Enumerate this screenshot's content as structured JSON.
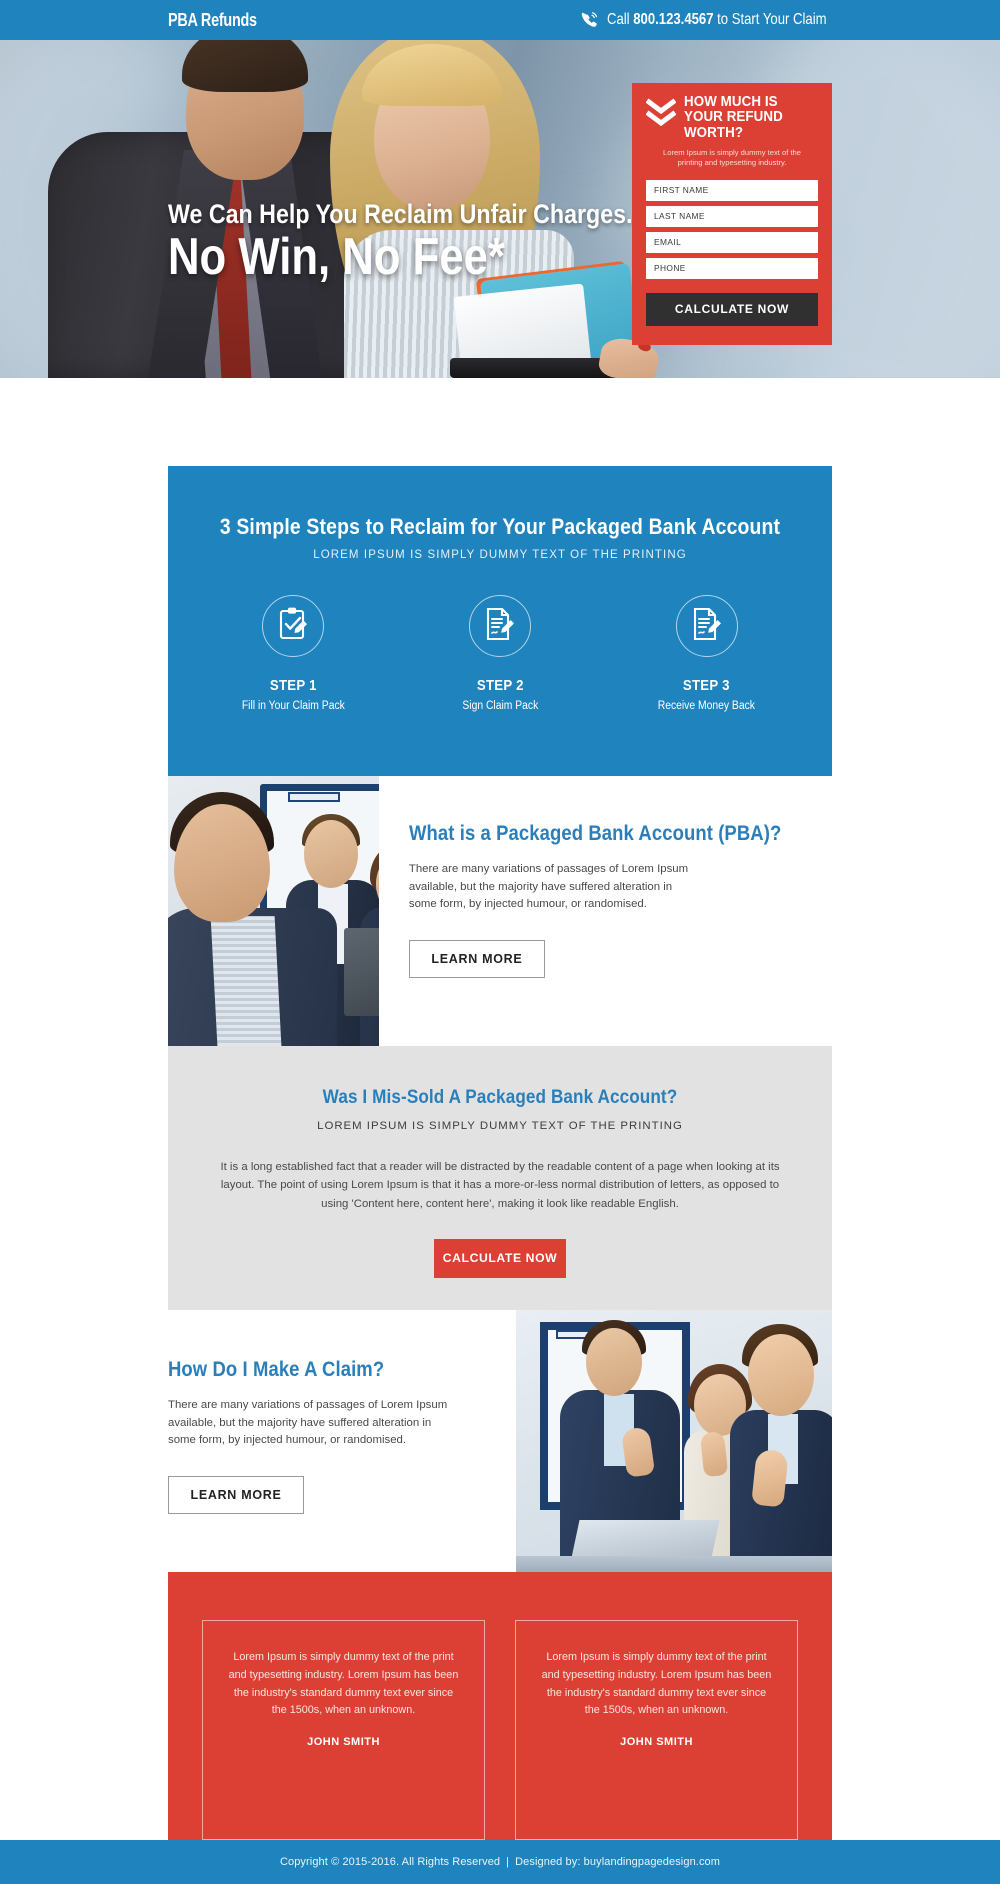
{
  "header": {
    "brand_bold": "PBA",
    "brand_light": " Refunds",
    "phone_icon": "phone-ringing-icon",
    "call_prefix": "Call ",
    "call_number": "800.123.4567",
    "call_suffix": " to Start Your Claim"
  },
  "hero": {
    "headline_line1": "We Can Help You Reclaim Unfair Charges.",
    "headline_line2": "No Win, No Fee*",
    "image_alt": "businessman-and-woman-reviewing-documents"
  },
  "lead_form": {
    "chevron_icon": "double-chevron-down-icon",
    "title": "HOW MUCH IS YOUR REFUND WORTH?",
    "subtitle": "Lorem Ipsum is simply dummy text of the printing and typesetting industry.",
    "fields": [
      {
        "name": "first-name",
        "placeholder": "FIRST NAME",
        "value": ""
      },
      {
        "name": "last-name",
        "placeholder": "LAST NAME",
        "value": ""
      },
      {
        "name": "email",
        "placeholder": "EMAIL",
        "value": ""
      },
      {
        "name": "phone",
        "placeholder": "PHONE",
        "value": ""
      }
    ],
    "submit_label": "CALCULATE NOW"
  },
  "steps_section": {
    "title": "3 Simple Steps to Reclaim for Your Packaged Bank Account",
    "subtitle": "LOREM IPSUM IS SIMPLY DUMMY TEXT OF THE PRINTING",
    "steps": [
      {
        "icon": "clipboard-check-pencil-icon",
        "name": "STEP 1",
        "desc": "Fill in Your Claim Pack"
      },
      {
        "icon": "document-pencil-icon",
        "name": "STEP 2",
        "desc": "Sign Claim Pack"
      },
      {
        "icon": "document-pencil-icon",
        "name": "STEP 3",
        "desc": "Receive Money Back"
      }
    ]
  },
  "pba_section": {
    "image_alt": "business-team-in-office",
    "title": "What is a Packaged Bank Account (PBA)?",
    "body": "There are many variations of passages of Lorem Ipsum available, but the majority have suffered alteration in some form, by injected humour, or randomised.",
    "button_label": "LEARN MORE"
  },
  "missold_section": {
    "title": "Was I Mis-Sold A Packaged Bank Account?",
    "subtitle": "LOREM IPSUM IS SIMPLY DUMMY TEXT OF THE PRINTING",
    "body": "It is a long established fact that a reader will be distracted by the readable content of a page when looking at its layout. The point of using Lorem Ipsum is that it has a more-or-less normal distribution of letters, as opposed to using 'Content here, content here', making it look like readable English.",
    "button_label": "CALCULATE NOW"
  },
  "claim_section": {
    "title": "How Do I Make A Claim?",
    "body": "There are many variations of passages of Lorem Ipsum available, but the majority have suffered alteration in some form, by injected humour, or randomised.",
    "button_label": "LEARN MORE",
    "image_alt": "business-team-giving-thumbs-up"
  },
  "testimonials": [
    {
      "text": "Lorem Ipsum is simply dummy text of the print and typesetting industry. Lorem Ipsum has been the industry's standard dummy text ever since the 1500s, when an unknown.",
      "name": "JOHN SMITH"
    },
    {
      "text": "Lorem Ipsum is simply dummy text of the print and typesetting industry. Lorem Ipsum has been the industry's standard dummy text ever since the 1500s, when an unknown.",
      "name": "JOHN SMITH"
    }
  ],
  "footer": {
    "copyright": "Copyright © 2015-2016. All Rights Reserved",
    "separator": "|",
    "credit": "Designed by: buylandingpagedesign.com"
  },
  "colors": {
    "brand_blue": "#1f83bd",
    "accent_red": "#dc4034",
    "dark_button": "#303030",
    "gray_section": "#e2e2e2",
    "heading_blue": "#2a7fba"
  }
}
